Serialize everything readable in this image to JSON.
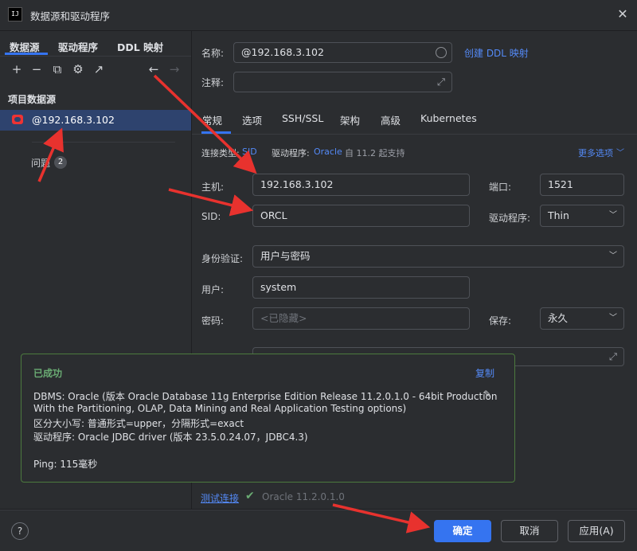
{
  "window": {
    "title": "数据源和驱动程序",
    "app_icon": "IJ"
  },
  "left": {
    "tabs": [
      "数据源",
      "驱动程序",
      "DDL 映射"
    ],
    "section_title": "项目数据源",
    "datasource": "@192.168.3.102",
    "problems_label": "问题",
    "problems_count": "2"
  },
  "form": {
    "name_label": "名称:",
    "name_value": "@192.168.3.102",
    "create_ddl_link": "创建 DDL 映射",
    "comment_label": "注释:",
    "tabs": [
      "常规",
      "选项",
      "SSH/SSL",
      "架构",
      "高级",
      "Kubernetes"
    ],
    "conn_type_label": "连接类型:",
    "conn_type_value": "SID",
    "driver_label_top": "驱动程序:",
    "driver_link": "Oracle",
    "driver_hint": "自 11.2 起支持",
    "more_options": "更多选项",
    "host_label": "主机:",
    "host_value": "192.168.3.102",
    "port_label": "端口:",
    "port_value": "1521",
    "sid_label": "SID:",
    "sid_value": "ORCL",
    "driver_label": "驱动程序:",
    "driver_value": "Thin",
    "auth_label": "身份验证:",
    "auth_value": "用户与密码",
    "user_label": "用户:",
    "user_value": "system",
    "password_label": "密码:",
    "password_placeholder": "<已隐藏>",
    "save_label": "保存:",
    "save_value": "永久"
  },
  "popup": {
    "title": "已成功",
    "copy": "复制",
    "lines": [
      "DBMS: Oracle (版本 Oracle Database 11g Enterprise Edition Release 11.2.0.1.0 - 64bit Production",
      "With the Partitioning, OLAP, Data Mining and Real Application Testing options)",
      "区分大小写: 普通形式=upper，分隔形式=exact",
      "驱动程序: Oracle JDBC driver (版本 23.5.0.24.07，JDBC4.3)",
      "Ping: 115毫秒"
    ]
  },
  "test": {
    "link": "测试连接",
    "version": "Oracle 11.2.0.1.0"
  },
  "buttons": {
    "help": "?",
    "ok": "确定",
    "cancel": "取消",
    "apply": "应用(A)"
  },
  "colors": {
    "accent": "#3574f0",
    "link": "#548af7",
    "success": "#6aab73",
    "annotation_arrow": "#e8322e"
  }
}
